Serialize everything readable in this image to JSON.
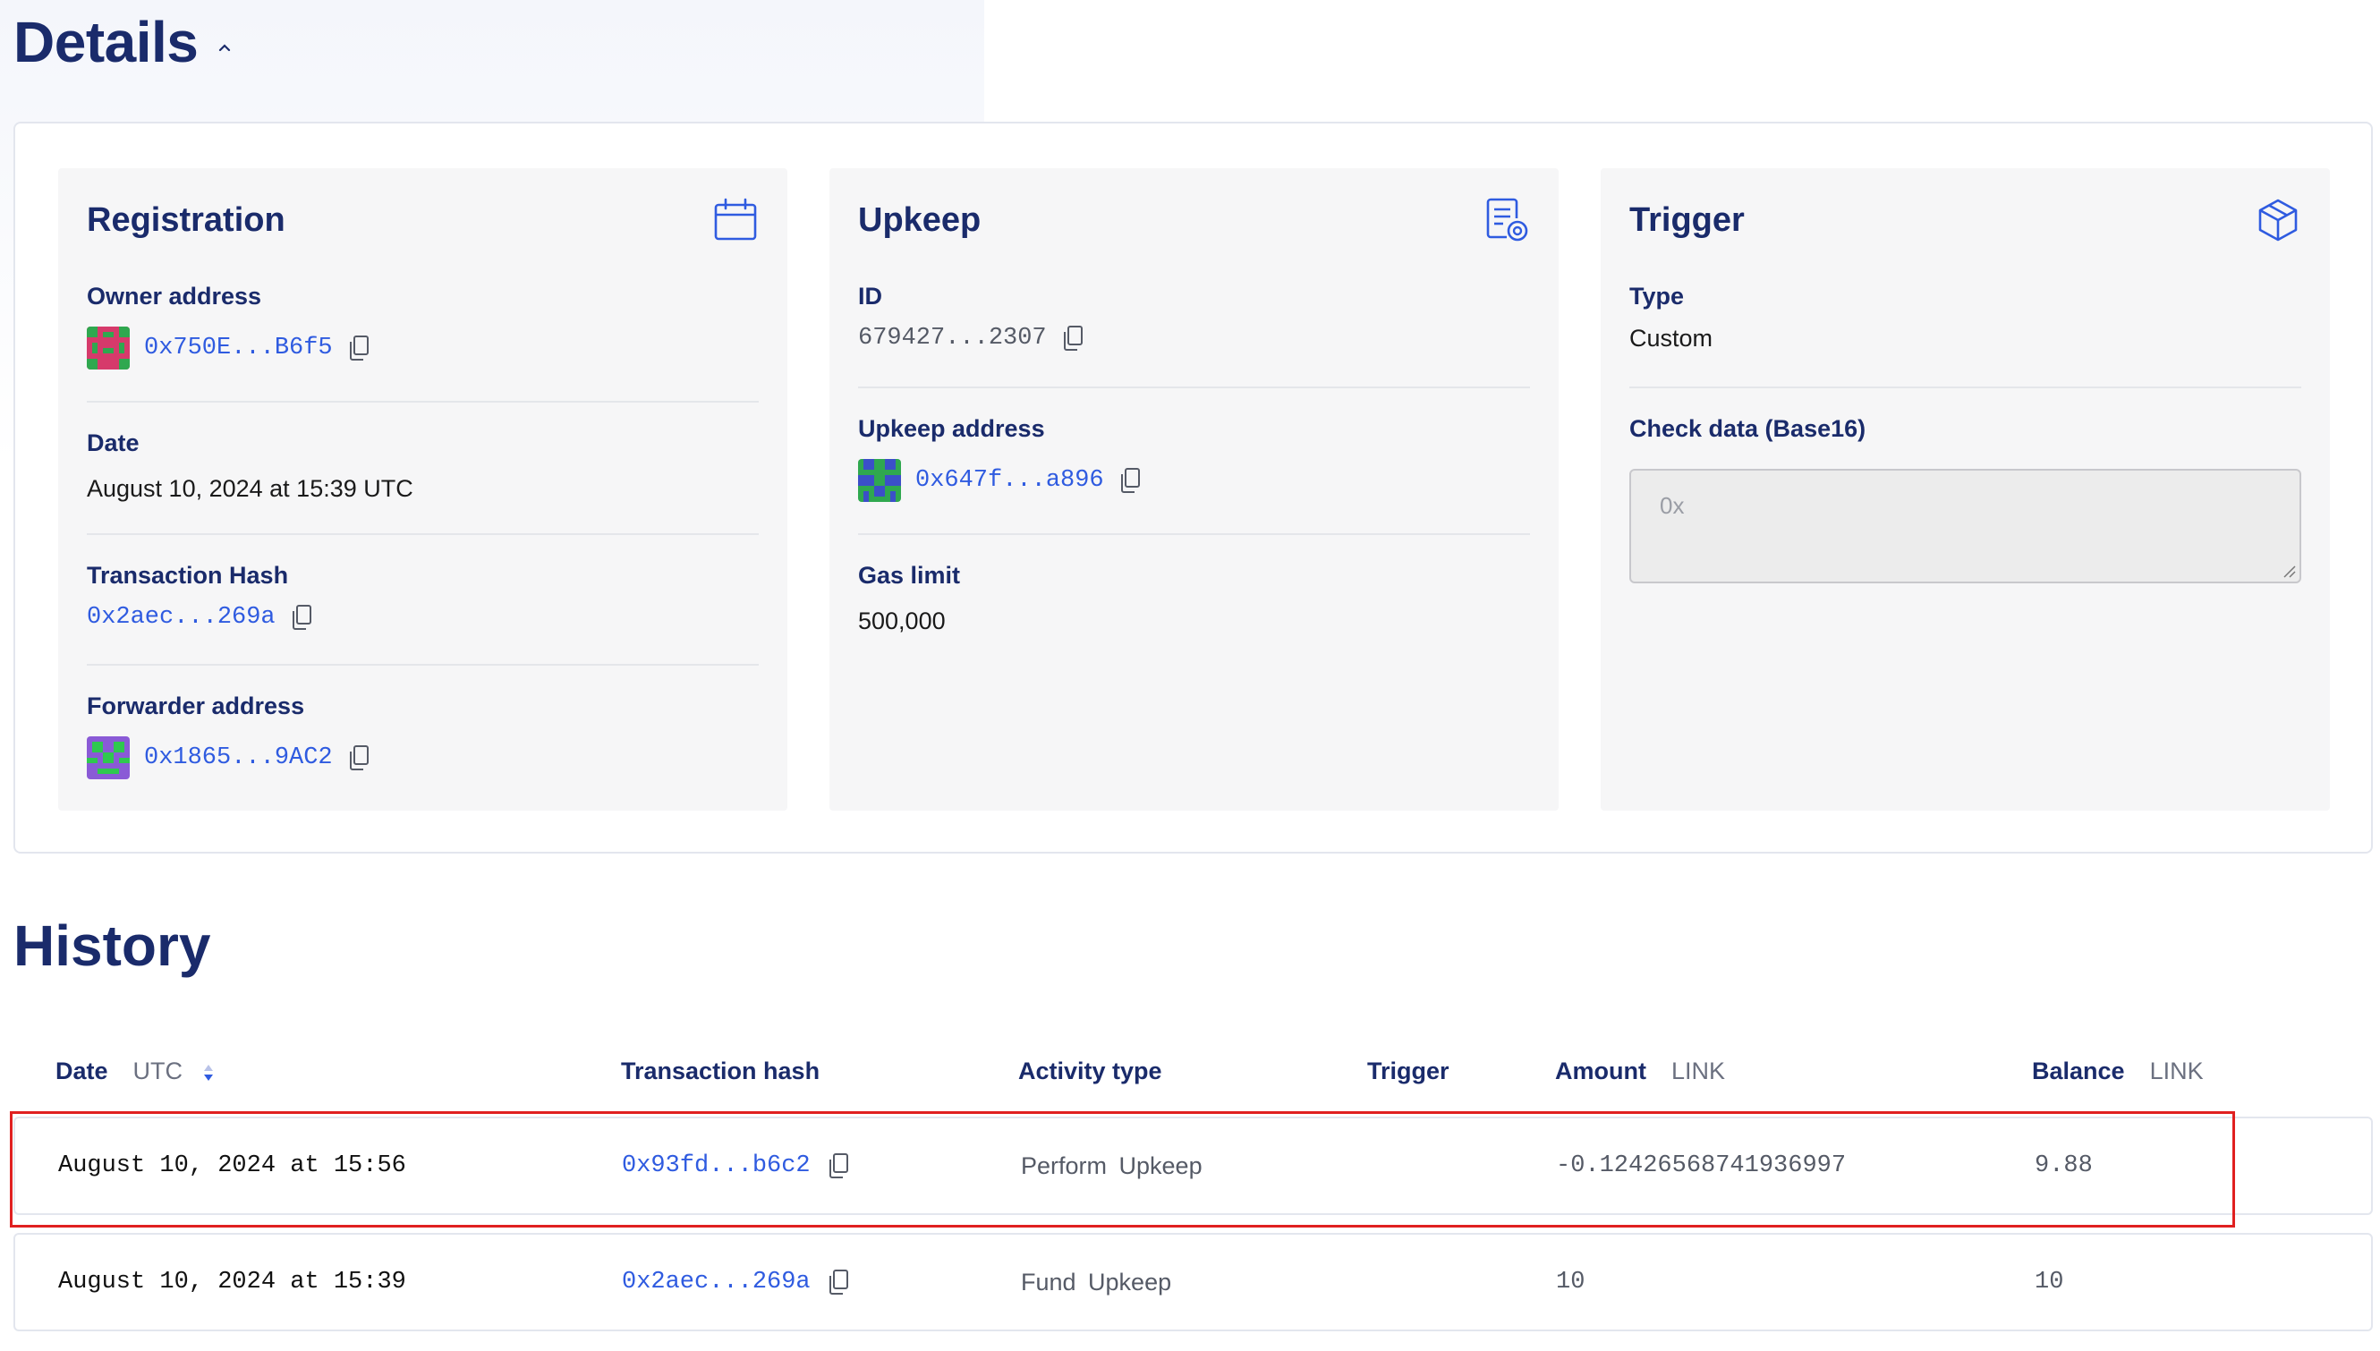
{
  "details": {
    "title": "Details"
  },
  "registration": {
    "title": "Registration",
    "owner_label": "Owner address",
    "owner_value": "0x750E...B6f5",
    "date_label": "Date",
    "date_value": "August 10, 2024 at 15:39 UTC",
    "tx_label": "Transaction Hash",
    "tx_value": "0x2aec...269a",
    "forwarder_label": "Forwarder address",
    "forwarder_value": "0x1865...9AC2"
  },
  "upkeep": {
    "title": "Upkeep",
    "id_label": "ID",
    "id_value": "679427...2307",
    "address_label": "Upkeep address",
    "address_value": "0x647f...a896",
    "gas_label": "Gas limit",
    "gas_value": "500,000"
  },
  "trigger": {
    "title": "Trigger",
    "type_label": "Type",
    "type_value": "Custom",
    "check_label": "Check data (Base16)",
    "check_placeholder": "0x"
  },
  "history": {
    "title": "History",
    "columns": {
      "date": "Date",
      "date_unit": "UTC",
      "hash": "Transaction hash",
      "activity": "Activity type",
      "trigger": "Trigger",
      "amount": "Amount",
      "amount_unit": "LINK",
      "balance": "Balance",
      "balance_unit": "LINK"
    },
    "rows": [
      {
        "date": "August 10, 2024 at 15:56",
        "hash": "0x93fd...b6c2",
        "activity": "Perform Upkeep",
        "trigger": "",
        "amount": "-0.12426568741936997",
        "balance": "9.88"
      },
      {
        "date": "August 10, 2024 at 15:39",
        "hash": "0x2aec...269a",
        "activity": "Fund Upkeep",
        "trigger": "",
        "amount": "10",
        "balance": "10"
      }
    ]
  },
  "colors": {
    "heading": "#1a2b6b",
    "link": "#2f5be0",
    "highlight": "#e02020"
  },
  "icons": [
    "chevron-up-icon",
    "calendar-icon",
    "document-gear-icon",
    "cube-icon",
    "copy-icon",
    "sort-icon",
    "identicon-avatar"
  ]
}
